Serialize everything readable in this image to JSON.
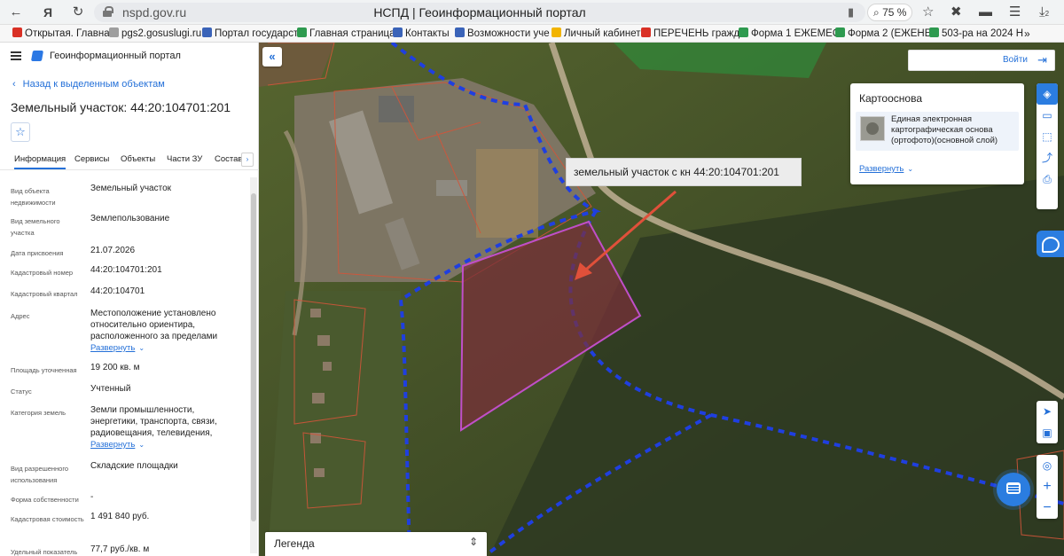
{
  "browser": {
    "url": "nspd.gov.ru",
    "page_title": "НСПД | Геоинформационный портал",
    "zoom": "75 %",
    "downloads_badge": "2"
  },
  "bookmarks": [
    {
      "label": "Открытая. Главна",
      "color": "#d93025"
    },
    {
      "label": "pgs2.gosuslugi.ru",
      "color": "#9e9e9e"
    },
    {
      "label": "Портал государст",
      "color": "#3a63b8"
    },
    {
      "label": "Главная страница",
      "color": "#2e9a4f"
    },
    {
      "label": "Контакты",
      "color": "#3a63b8"
    },
    {
      "label": "Возможности уче",
      "color": "#3a63b8"
    },
    {
      "label": "Личный кабинет",
      "color": "#f2b400"
    },
    {
      "label": "ПЕРЕЧЕНЬ гражд",
      "color": "#d93025"
    },
    {
      "label": "Форма 1 ЕЖЕМЕС",
      "color": "#2e9a4f"
    },
    {
      "label": "Форма 2 (ЕЖЕНЕ",
      "color": "#2e9a4f"
    },
    {
      "label": "503-ра на 2024 Н",
      "color": "#2e9a4f"
    }
  ],
  "panel": {
    "portal_title": "Геоинформационный портал",
    "back_link": "Назад к выделенным объектам",
    "object_title": "Земельный участок: 44:20:104701:201",
    "tabs": [
      "Информация",
      "Сервисы",
      "Объекты",
      "Части ЗУ",
      "Состав"
    ],
    "expand_label": "Развернуть",
    "attributes": [
      {
        "key": "Вид объекта недвижимости",
        "value": "Земельный участок"
      },
      {
        "key": "Вид земельного участка",
        "value": "Землепользование"
      },
      {
        "key": "Дата присвоения",
        "value": "21.07.2026"
      },
      {
        "key": "Кадастровый номер",
        "value": "44:20:104701:201"
      },
      {
        "key": "Кадастровый квартал",
        "value": "44:20:104701"
      },
      {
        "key": "Адрес",
        "value": "Местоположение установлено относительно ориентира, расположенного за пределами"
      },
      {
        "key": "Площадь уточненная",
        "value": "19 200 кв. м"
      },
      {
        "key": "Статус",
        "value": "Учтенный"
      },
      {
        "key": "Категория земель",
        "value": "Земли промышленности, энергетики, транспорта, связи, радиовещания, телевидения,"
      },
      {
        "key": "Вид разрешенного использования",
        "value": "Складские площадки"
      },
      {
        "key": "Форма собственности",
        "value": "-"
      },
      {
        "key": "Кадастровая стоимость",
        "value": "1 491 840 руб."
      },
      {
        "key": "Удельный показатель",
        "value": "77,7 руб./кв. м"
      }
    ]
  },
  "map": {
    "login_label": "Войти",
    "basemap_title": "Картооснова",
    "basemap_item": "Единая электронная картографическая основа (ортофото)(основной слой)",
    "basemap_expand": "Развернуть",
    "callout": "земельный участок с кн 44:20:104701:201",
    "legend_label": "Легенда",
    "colors": {
      "parcel_fill": "#7a2f3a",
      "parcel_border": "#c04fc8",
      "boundary": "#1f3fe0",
      "arrow": "#e0503a",
      "accent": "#2470d8"
    }
  }
}
